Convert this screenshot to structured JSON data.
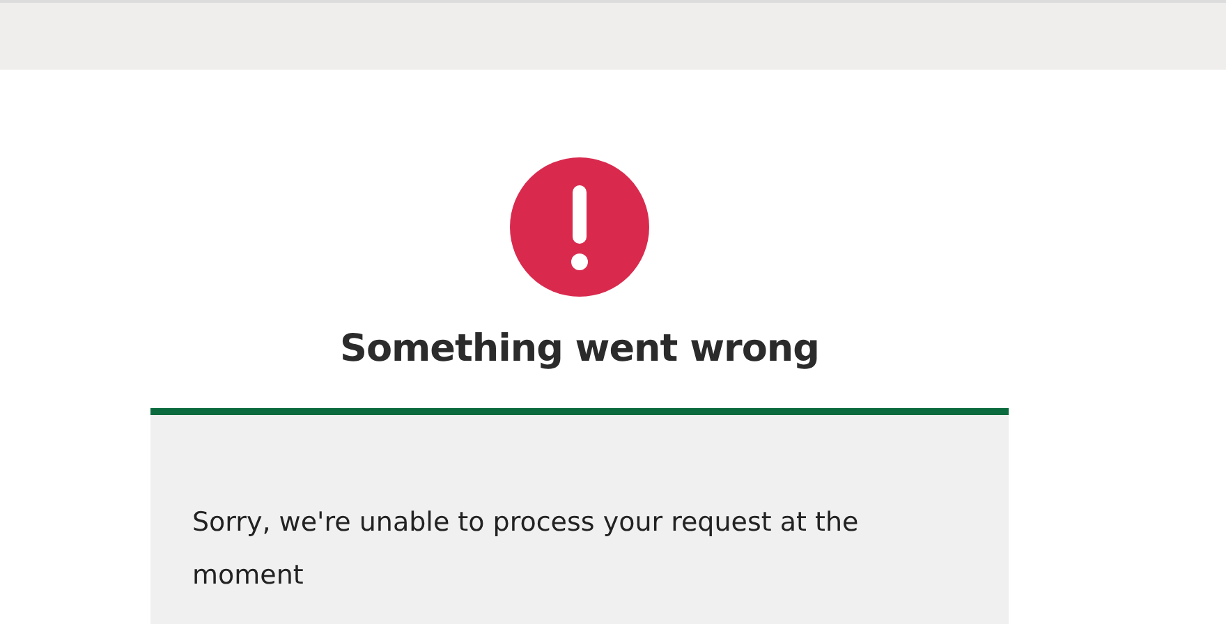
{
  "error": {
    "title": "Something went wrong",
    "message": "Sorry, we're unable to process your request at the moment"
  }
}
